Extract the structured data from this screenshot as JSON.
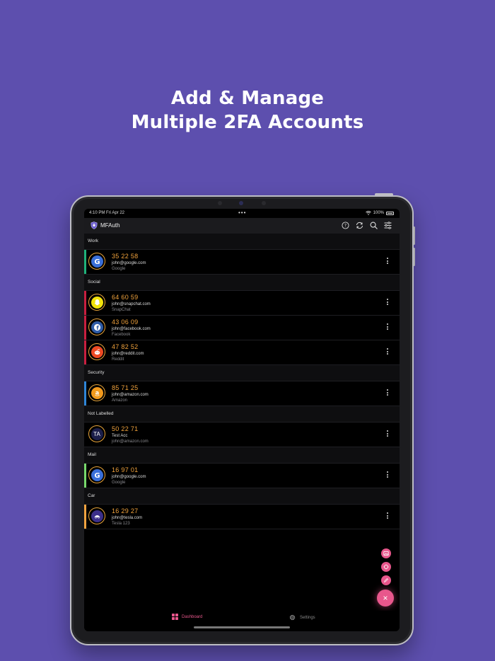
{
  "headline": {
    "line1": "Add & Manage",
    "line2": "Multiple 2FA Accounts"
  },
  "status": {
    "time": "4:10 PM  Fri Apr 22",
    "battery": "100%",
    "dots": "•••"
  },
  "app": {
    "title": "MFAuth",
    "icons": [
      "help-icon",
      "sync-icon",
      "search-icon",
      "filter-icon"
    ]
  },
  "sections": [
    {
      "label": "Work",
      "color": "#1fb27a",
      "rows": [
        {
          "code": "35 22 58",
          "email": "john@google.com",
          "service": "Google",
          "icon": "google",
          "bg": "#3a6fd8"
        }
      ]
    },
    {
      "label": "Social",
      "color": "#c91f3f",
      "rows": [
        {
          "code": "64 60 59",
          "email": "john@snapchat.com",
          "service": "SnapChat",
          "icon": "snapchat",
          "bg": "#f3e30b"
        },
        {
          "code": "43 06 09",
          "email": "john@facebook.com",
          "service": "Facebook",
          "icon": "facebook",
          "bg": "#2f5ca6"
        },
        {
          "code": "47 82 52",
          "email": "john@reddit.com",
          "service": "Reddit",
          "icon": "reddit",
          "bg": "#ee4a23"
        }
      ]
    },
    {
      "label": "Security",
      "color": "#2f86d8",
      "rows": [
        {
          "code": "85 71 25",
          "email": "john@amazon.com",
          "service": "Amazon",
          "icon": "amazon",
          "bg": "#f39a1c"
        }
      ]
    },
    {
      "label": "Not Labelled",
      "color": "",
      "rows": [
        {
          "code": "50 22 71",
          "email": "Test Acc",
          "service": "john@amazon.com",
          "icon": "initials",
          "initials": "TA",
          "bg": "#1b1e4a"
        }
      ]
    },
    {
      "label": "Mail",
      "color": "#78d96c",
      "rows": [
        {
          "code": "16 97 01",
          "email": "john@google.com",
          "service": "Google",
          "icon": "google",
          "bg": "#3a6fd8"
        }
      ]
    },
    {
      "label": "Car",
      "color": "#f2a340",
      "rows": [
        {
          "code": "16 29 27",
          "email": "john@tesla.com",
          "service": "Tesla 123",
          "icon": "tesla",
          "bg": "#3c2f8a"
        }
      ]
    }
  ],
  "fabs": [
    "image-icon",
    "scan-icon",
    "edit-icon"
  ],
  "nav": {
    "dashboard": "Dashboard",
    "settings": "Settings"
  },
  "colors": {
    "accent": "#e8578c",
    "code": "#f0a23c",
    "background": "#5d4fae"
  }
}
